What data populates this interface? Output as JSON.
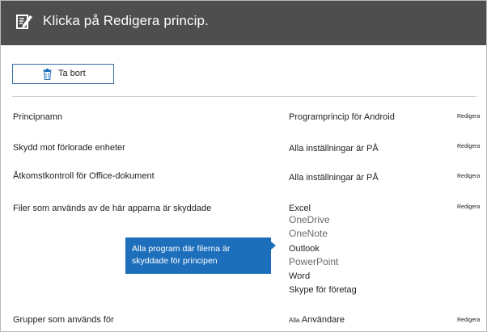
{
  "header": {
    "title": "Klicka på Redigera princip."
  },
  "toolbar": {
    "delete_label": "Ta bort"
  },
  "rows": [
    {
      "label": "Principnamn",
      "value": "Programprincip för Android",
      "edit_label": "Redigera"
    },
    {
      "label": "Skydd mot förlorade enheter",
      "value": "Alla inställningar är PÅ",
      "edit_label": "Redigera"
    },
    {
      "label": "Åtkomstkontroll för Office-dokument",
      "value": "Alla inställningar är PÅ",
      "edit_label": "Redigera"
    },
    {
      "label": "Filer som används av de här apparna är skyddade",
      "value": "Excel",
      "edit_label": "Redigera"
    },
    {
      "label": "Grupper som används för",
      "value_prefix": "Alla",
      "value": "Användare",
      "edit_label": "Redigera"
    }
  ],
  "apps": [
    "OneDrive",
    "OneNote",
    "Outlook",
    "PowerPoint",
    "Word",
    "Skype för företag"
  ],
  "callout": {
    "line1": "Alla program där filerna är",
    "line2": "skyddade för principen"
  },
  "colors": {
    "header_bg": "#4e4e4e",
    "callout_bg": "#1e6fbb",
    "button_border": "#3b6ea5"
  },
  "icons": {
    "header": "edit-policy-icon",
    "delete": "trash-icon"
  }
}
